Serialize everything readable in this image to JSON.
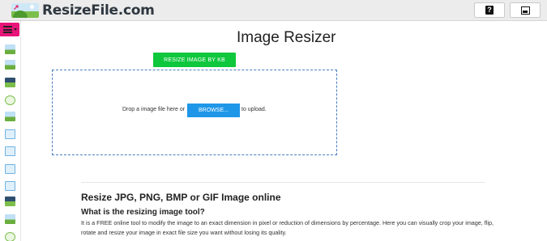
{
  "header": {
    "logo_text": "ResizeFile.com",
    "help_icon": "question-icon",
    "save_icon": "floppy-save-icon"
  },
  "sidebar": {
    "menu_icon": "hamburger-menu-icon",
    "menu_color": "#e8157a",
    "tools": [
      "resize-image-icon",
      "resize-kb-icon",
      "crop-image-icon",
      "flip-image-icon",
      "rotate-image-icon",
      "convert-doc-icon",
      "compress-doc-icon",
      "jpg-doc-icon",
      "png-doc-icon",
      "dark-image-icon",
      "film-image-icon",
      "rotate-circle-icon",
      "photo-icon"
    ]
  },
  "main": {
    "title": "Image Resizer",
    "kb_button_label": "RESIZE IMAGE BY KB",
    "kb_button_color": "#0ec73d",
    "drop_text_before": "Drop a image file here or",
    "browse_label": "BROWSE...",
    "browse_color": "#1f97e8",
    "drop_text_after": "to upload."
  },
  "info": {
    "heading": "Resize JPG, PNG, BMP or GIF Image online",
    "subheading": "What is the resizing image tool?",
    "description": "It is a FREE online tool to modify the image to an exact dimension in pixel or reduction of dimensions by percentage. Here you can visually crop your image, flip, rotate and resize your image in exact file size you want without losing its quality."
  }
}
